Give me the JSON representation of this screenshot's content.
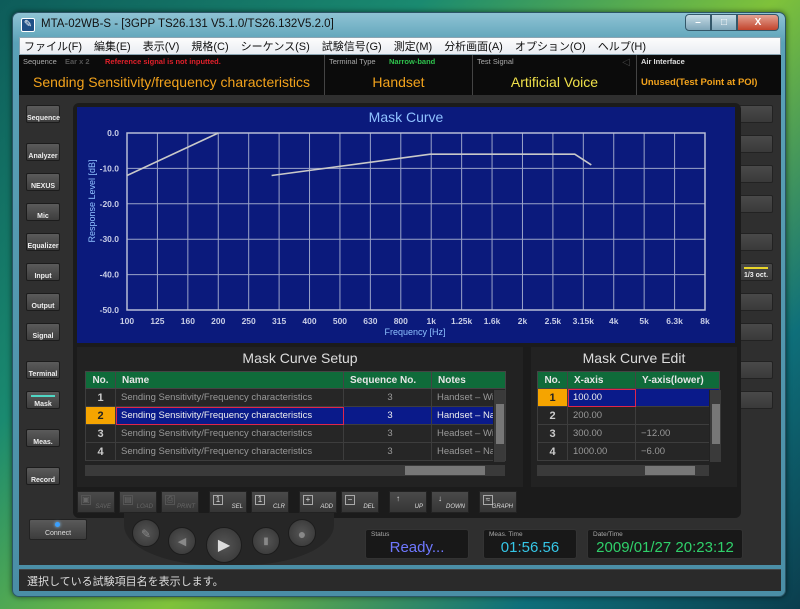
{
  "window": {
    "title": "MTA-02WB-S - [3GPP TS26.131 V5.1.0/TS26.132V5.2.0]",
    "buttons": {
      "minimize": "–",
      "maximize": "□",
      "close": "X"
    }
  },
  "menu": [
    "ファイル(F)",
    "編集(E)",
    "表示(V)",
    "規格(C)",
    "シーケンス(S)",
    "試験信号(G)",
    "測定(M)",
    "分析画面(A)",
    "オプション(O)",
    "ヘルプ(H)"
  ],
  "info": {
    "sequence_label": "Sequence",
    "ear_label": "Ear x 2",
    "warning": "Reference signal is not inputted.",
    "sequence_value": "Sending Sensitivity/frequency characteristics",
    "terminal_label": "Terminal Type",
    "terminal_band": "Narrow-band",
    "terminal_value": "Handset",
    "signal_label": "Test Signal",
    "signal_value": "Artificial Voice",
    "air_label": "Air Interface",
    "air_value": "Unused(Test Point at POI)"
  },
  "left_nav": [
    "Sequence",
    "Analyzer",
    "NEXUS",
    "Mic",
    "Equalizer",
    "Input",
    "Output",
    "Signal",
    "Terminal",
    "Mask",
    "Meas.",
    "Record"
  ],
  "left_nav_active": "Mask",
  "right_nav": [
    "",
    "",
    "",
    "",
    "",
    "1/3 oct.",
    "",
    "",
    "",
    ""
  ],
  "right_nav_active": "1/3 oct.",
  "chart_data": {
    "type": "line",
    "title": "Mask Curve",
    "xlabel": "Frequency [Hz]",
    "ylabel": "Response Level [dB]",
    "x_scale": "1/3-octave categorical (log)",
    "x_ticks": [
      "100",
      "125",
      "160",
      "200",
      "250",
      "315",
      "400",
      "500",
      "630",
      "800",
      "1k",
      "1.25k",
      "1.6k",
      "2k",
      "2.5k",
      "3.15k",
      "4k",
      "5k",
      "6.3k",
      "8k"
    ],
    "y_ticks": [
      "0.0",
      "-10.0",
      "-20.0",
      "-30.0",
      "-40.0",
      "-50.0"
    ],
    "ylim": [
      -50,
      0
    ],
    "xlim": [
      100,
      8000
    ],
    "grid": true,
    "series": [
      {
        "name": "upper",
        "points": [
          [
            100,
            -12
          ],
          [
            200,
            0
          ]
        ]
      },
      {
        "name": "lower",
        "points": [
          [
            300,
            -12
          ],
          [
            1000,
            -6
          ],
          [
            3000,
            -6
          ],
          [
            3400,
            -9
          ]
        ]
      }
    ]
  },
  "setup": {
    "title": "Mask Curve Setup",
    "columns": [
      "No.",
      "Name",
      "Sequence No.",
      "Notes"
    ],
    "rows": [
      {
        "no": "1",
        "name": "Sending Sensitivity/Frequency characteristics",
        "seq": "3",
        "notes": "Handset – Wide"
      },
      {
        "no": "2",
        "name": "Sending Sensitivity/Frequency characteristics",
        "seq": "3",
        "notes": "Handset – Narr"
      },
      {
        "no": "3",
        "name": "Sending Sensitivity/Frequency characteristics",
        "seq": "3",
        "notes": "Headset – Wide"
      },
      {
        "no": "4",
        "name": "Sending Sensitivity/Frequency characteristics",
        "seq": "3",
        "notes": "Headset – Narr"
      }
    ],
    "selected": 1
  },
  "edit": {
    "title": "Mask Curve Edit",
    "columns": [
      "No.",
      "X-axis",
      "Y-axis(lower)"
    ],
    "rows": [
      {
        "no": "1",
        "x": "100.00",
        "y": ""
      },
      {
        "no": "2",
        "x": "200.00",
        "y": ""
      },
      {
        "no": "3",
        "x": "300.00",
        "y": "−12.00"
      },
      {
        "no": "4",
        "x": "1000.00",
        "y": "−6.00"
      }
    ],
    "selected": 0
  },
  "toolbar": [
    {
      "label": "SAVE",
      "icon": "▣",
      "enabled": false
    },
    {
      "label": "LOAD",
      "icon": "▤",
      "enabled": false
    },
    {
      "label": "PRINT",
      "icon": "⎙",
      "enabled": false
    },
    {
      "label": "SEL",
      "icon": "1",
      "enabled": true
    },
    {
      "label": "CLR",
      "icon": "1",
      "enabled": true
    },
    {
      "label": "ADD",
      "icon": "+",
      "enabled": true
    },
    {
      "label": "DEL",
      "icon": "−",
      "enabled": true
    },
    {
      "label": "UP",
      "icon": "↑",
      "enabled": true
    },
    {
      "label": "DOWN",
      "icon": "↓",
      "enabled": true
    },
    {
      "label": "GRAPH",
      "icon": "≈",
      "enabled": true
    }
  ],
  "bottom": {
    "connect": "Connect",
    "status_label": "Status",
    "status_value": "Ready...",
    "meas_label": "Meas. Time",
    "meas_value": "01:56.56",
    "date_label": "Date/Time",
    "date_value": "2009/01/27 20:23:12",
    "status_color": "#6f78ff",
    "meas_color": "#35c6e6",
    "date_color": "#2fd06a"
  },
  "statusbar": "選択している試験項目名を表示します。"
}
